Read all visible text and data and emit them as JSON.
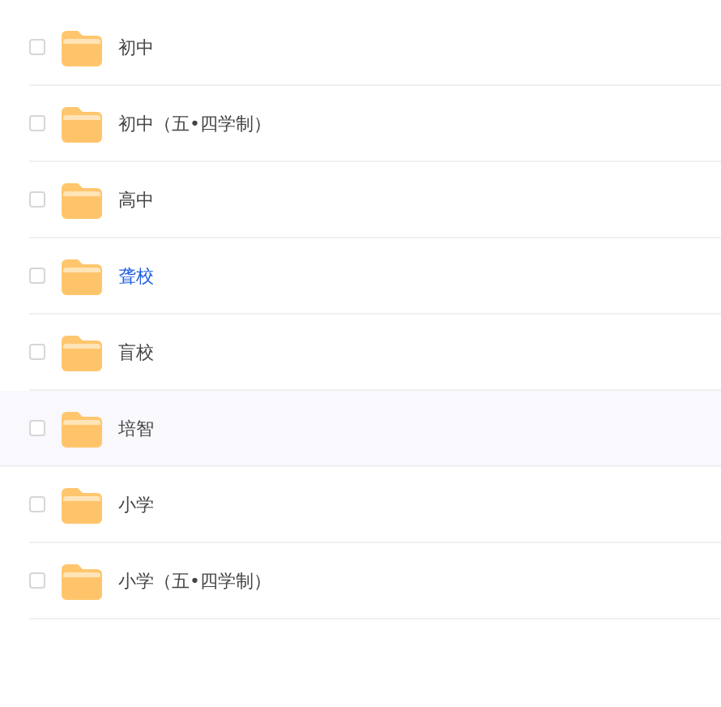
{
  "folders": [
    {
      "name": "初中",
      "checked": false,
      "link": false,
      "hovered": false
    },
    {
      "name": "初中（五•四学制）",
      "checked": false,
      "link": false,
      "hovered": false
    },
    {
      "name": "高中",
      "checked": false,
      "link": false,
      "hovered": false
    },
    {
      "name": "聋校",
      "checked": false,
      "link": true,
      "hovered": false
    },
    {
      "name": "盲校",
      "checked": false,
      "link": false,
      "hovered": false
    },
    {
      "name": "培智",
      "checked": false,
      "link": false,
      "hovered": true
    },
    {
      "name": "小学",
      "checked": false,
      "link": false,
      "hovered": false
    },
    {
      "name": "小学（五•四学制）",
      "checked": false,
      "link": false,
      "hovered": false
    }
  ]
}
